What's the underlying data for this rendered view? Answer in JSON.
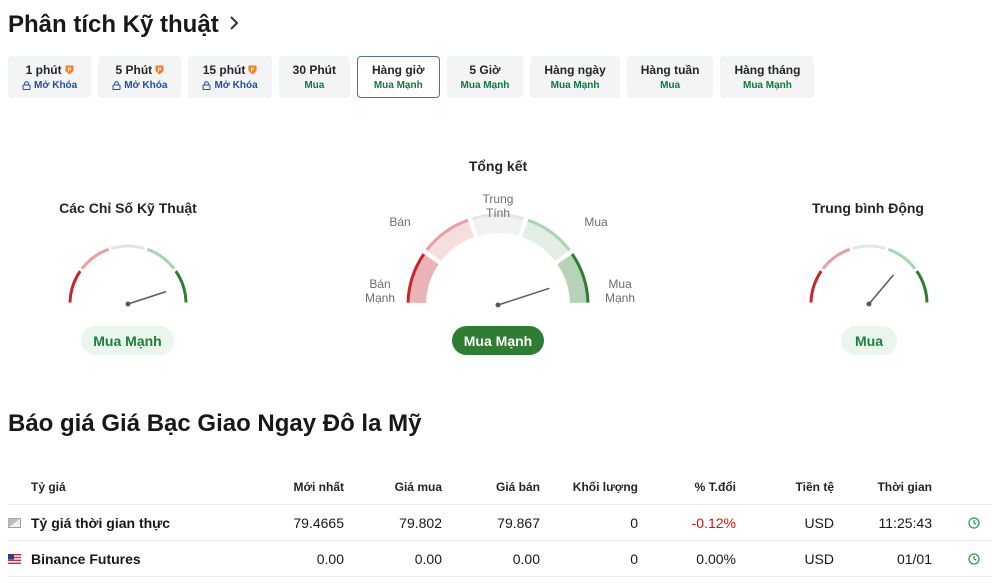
{
  "header": {
    "title": "Phân tích Kỹ thuật",
    "chevron_icon": "chevron-right-icon"
  },
  "tabs": [
    {
      "label": "1 phút",
      "sub": "Mở Khóa",
      "locked": true,
      "pro": true,
      "active": false
    },
    {
      "label": "5 Phút",
      "sub": "Mở Khóa",
      "locked": true,
      "pro": true,
      "active": false
    },
    {
      "label": "15 phút",
      "sub": "Mở Khóa",
      "locked": true,
      "pro": true,
      "active": false
    },
    {
      "label": "30 Phút",
      "sub": "Mua",
      "locked": false,
      "pro": false,
      "active": false
    },
    {
      "label": "Hàng giờ",
      "sub": "Mua Mạnh",
      "locked": false,
      "pro": false,
      "active": true
    },
    {
      "label": "5 Giờ",
      "sub": "Mua Mạnh",
      "locked": false,
      "pro": false,
      "active": false
    },
    {
      "label": "Hàng ngày",
      "sub": "Mua Mạnh",
      "locked": false,
      "pro": false,
      "active": false
    },
    {
      "label": "Hàng tuần",
      "sub": "Mua",
      "locked": false,
      "pro": false,
      "active": false
    },
    {
      "label": "Hàng tháng",
      "sub": "Mua Mạnh",
      "locked": false,
      "pro": false,
      "active": false
    }
  ],
  "gauges": {
    "indicators": {
      "title": "Các Chỉ Số Kỹ Thuật",
      "result": "Mua Mạnh"
    },
    "summary": {
      "title": "Tổng kết",
      "result": "Mua Mạnh",
      "labels": {
        "strong_sell": "Bán\nMạnh",
        "sell": "Bán",
        "neutral": "Trung\nTính",
        "buy": "Mua",
        "strong_buy": "Mua\nMạnh"
      }
    },
    "moving_averages": {
      "title": "Trung bình Động",
      "result": "Mua"
    }
  },
  "colors": {
    "strong_sell": "#c9252d",
    "sell": "#e8a0a0",
    "neutral": "#e3e6e8",
    "buy": "#a8d5b0",
    "strong_buy": "#2e7d32",
    "needle": "#555b61"
  },
  "quotes": {
    "title": "Báo giá Giá Bạc Giao Ngay Đô la Mỹ",
    "columns": [
      "Tỷ giá",
      "Mới nhất",
      "Giá mua",
      "Giá bán",
      "Khối lượng",
      "% T.đổi",
      "Tiền tệ",
      "Thời gian"
    ],
    "rows": [
      {
        "name": "Tỷ giá thời gian thực",
        "flag": "generic-flag-icon",
        "last": "79.4665",
        "bid": "79.802",
        "ask": "79.867",
        "volume": "0",
        "change": "-0.12%",
        "currency": "USD",
        "time": "11:25:43",
        "clock": "clock-icon"
      },
      {
        "name": "Binance Futures",
        "flag": "us-flag-icon",
        "last": "0.00",
        "bid": "0.00",
        "ask": "0.00",
        "volume": "0",
        "change": "0.00%",
        "currency": "USD",
        "time": "01/01",
        "clock": "clock-icon"
      }
    ]
  }
}
